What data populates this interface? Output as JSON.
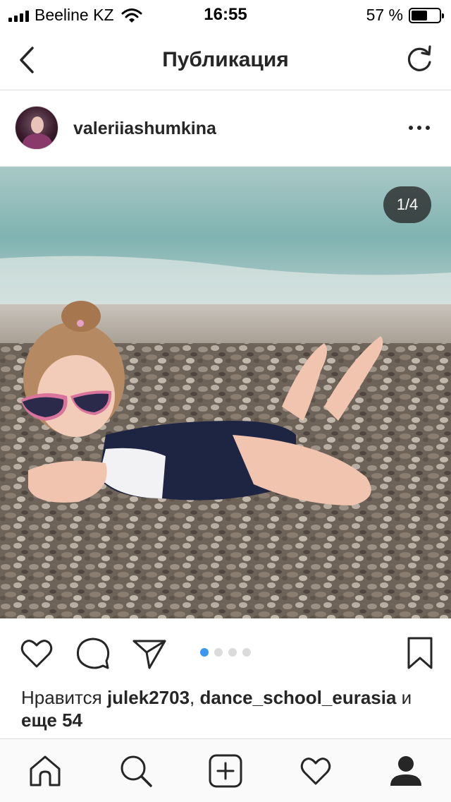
{
  "status_bar": {
    "carrier": "Beeline KZ",
    "time": "16:55",
    "battery_percent_text": "57 %",
    "battery_level": 0.57
  },
  "nav": {
    "title": "Публикация",
    "back_icon": "chevron-left-icon",
    "refresh_icon": "refresh-icon"
  },
  "post": {
    "username": "valeriiashumkina",
    "avatar_icon": "avatar",
    "more_icon": "more-horizontal-icon",
    "image_counter": "1/4",
    "carousel": {
      "total": 4,
      "active_index": 0
    },
    "likes": {
      "prefix": "Нравится ",
      "user1": "julek2703",
      "separator": ", ",
      "user2": "dance_school_eurasia",
      "and_text": " и ",
      "more_text": "еще 54"
    }
  },
  "actions": {
    "like_icon": "heart-icon",
    "comment_icon": "comment-icon",
    "share_icon": "send-icon",
    "save_icon": "bookmark-icon"
  },
  "tabbar": {
    "items": [
      "home-icon",
      "search-icon",
      "add-post-icon",
      "activity-heart-icon",
      "profile-icon"
    ]
  },
  "colors": {
    "accent_blue": "#3897f0",
    "text": "#262626",
    "divider": "#dbdbdb"
  }
}
